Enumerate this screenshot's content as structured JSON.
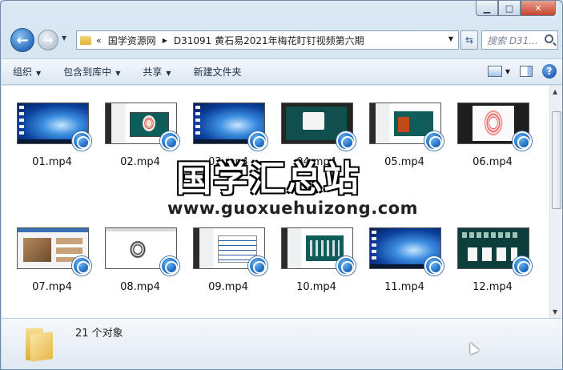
{
  "window": {
    "caption": {
      "minimize": "▁",
      "maximize": "□",
      "close": "✕"
    }
  },
  "nav": {
    "back": "←",
    "forward": "→",
    "path": {
      "overflow": "«",
      "parent": "国学资源网",
      "current": "D31091 黄石易2021年梅花盯钉视频第六期"
    },
    "refresh": "⇆",
    "search_placeholder": "搜索 D31..."
  },
  "toolbar": {
    "organize": "组织",
    "include_library": "包含到库中",
    "share": "共享",
    "new_folder": "新建文件夹"
  },
  "files": [
    {
      "name": "01.mp4",
      "thumb": "t-desk"
    },
    {
      "name": "02.mp4",
      "thumb": "t-slide"
    },
    {
      "name": "03.mp4",
      "thumb": "t-desk"
    },
    {
      "name": "04.mp4",
      "thumb": "t-dark"
    },
    {
      "name": "05.mp4",
      "thumb": "t-red"
    },
    {
      "name": "06.mp4",
      "thumb": "t-bagua"
    },
    {
      "name": "07.mp4",
      "thumb": "t-web"
    },
    {
      "name": "08.mp4",
      "thumb": "t-white"
    },
    {
      "name": "09.mp4",
      "thumb": "t-table"
    },
    {
      "name": "10.mp4",
      "thumb": "t-table2"
    },
    {
      "name": "11.mp4",
      "thumb": "t-desk"
    },
    {
      "name": "12.mp4",
      "thumb": "t-cards"
    }
  ],
  "watermark": {
    "title": "国学汇总站",
    "url": "www.guoxuehuizong.com"
  },
  "details": {
    "count": "21 个对象"
  },
  "colors": {
    "accent": "#2a6fc0",
    "close": "#c5442b",
    "background": "#ffffff"
  }
}
